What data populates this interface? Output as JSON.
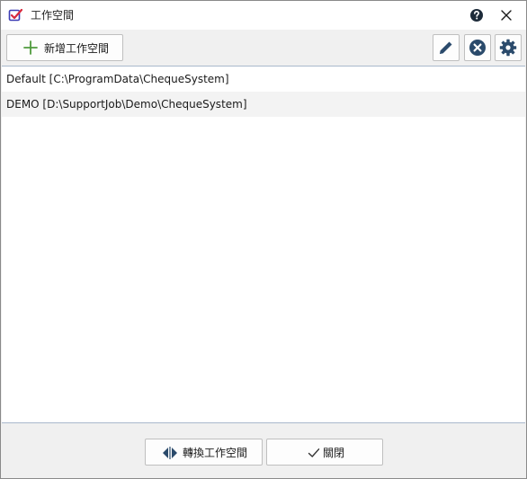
{
  "window": {
    "title": "工作空間",
    "app_icon": "checklist-icon",
    "help_icon": "question-circle-icon",
    "close_icon": "close-x-icon"
  },
  "toolbar": {
    "add_label": "新增工作空間",
    "add_icon": "plus-icon",
    "edit_icon": "pencil-icon",
    "delete_icon": "x-circle-icon",
    "settings_icon": "gear-icon",
    "accent": "#2a4a6b",
    "plus_color": "#4f9a3c"
  },
  "workspaces": [
    {
      "label": "Default [C:\\ProgramData\\ChequeSystem]"
    },
    {
      "label": "DEMO [D:\\SupportJob\\Demo\\ChequeSystem]"
    }
  ],
  "footer": {
    "switch_label": "轉換工作空間",
    "switch_icon": "left-right-arrows-icon",
    "close_label": "關閉",
    "close_icon": "checkmark-icon"
  }
}
